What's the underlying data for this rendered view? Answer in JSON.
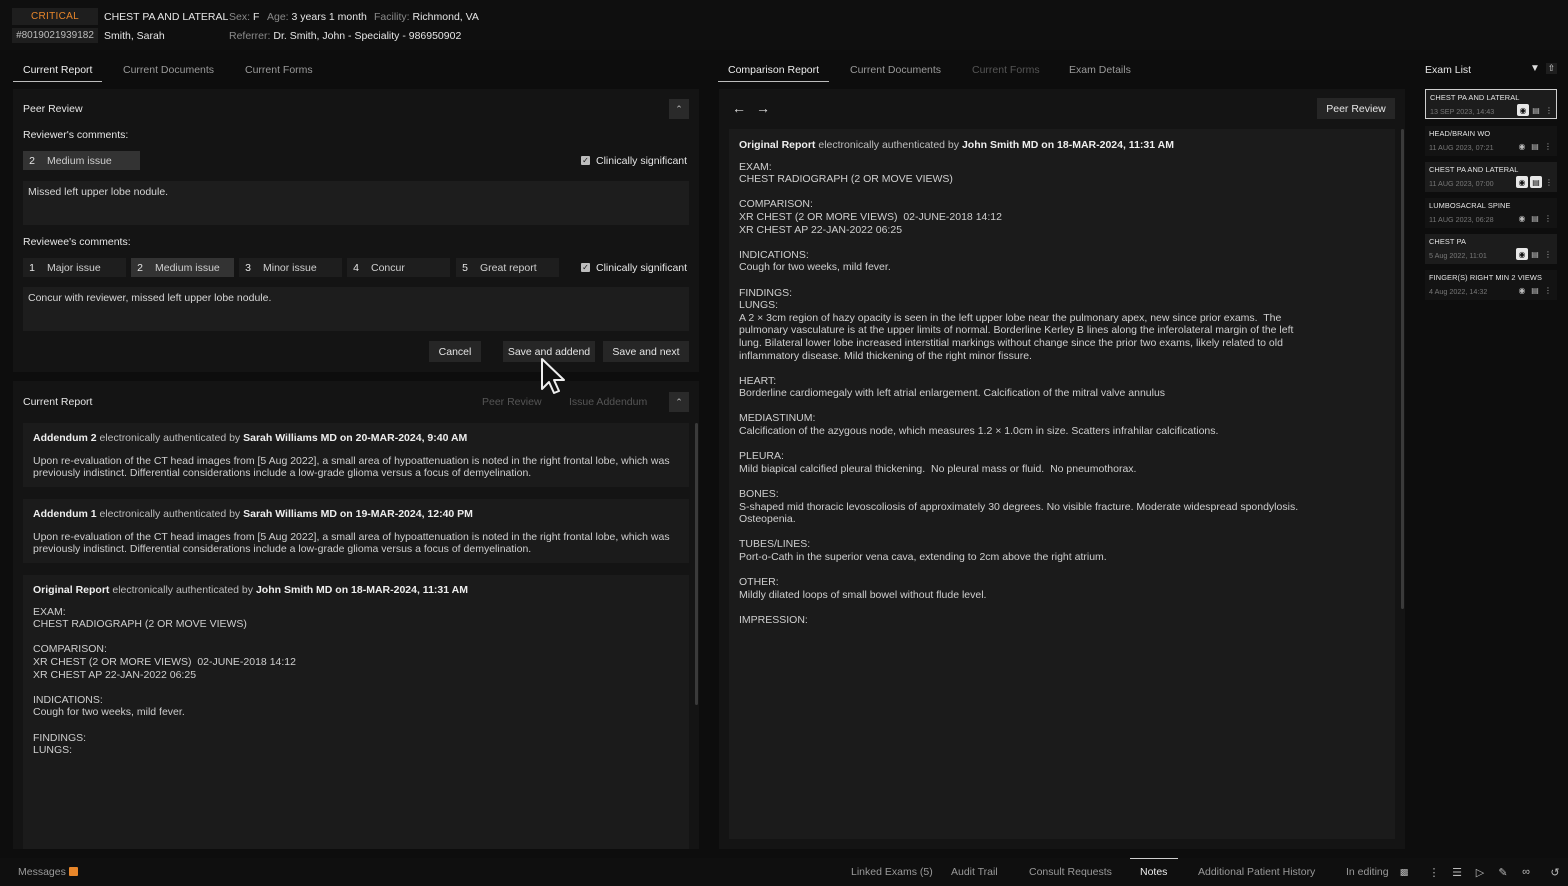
{
  "header": {
    "priority": "CRITICAL",
    "mrn": "#8019021939182",
    "exam_title": "CHEST PA AND LATERAL",
    "patient_name": "Smith, Sarah",
    "sex_label": "Sex:",
    "sex": "F",
    "age_label": "Age:",
    "age": "3 years 1 month",
    "facility_label": "Facility:",
    "facility": "Richmond, VA",
    "referrer_label": "Referrer:",
    "referrer": "Dr. Smith, John - Speciality - 986950902"
  },
  "left_tabs": [
    "Current Report",
    "Current Documents",
    "Current Forms"
  ],
  "right_tabs": [
    "Comparison Report",
    "Current Documents",
    "Current Forms",
    "Exam Details"
  ],
  "peer_review": {
    "title": "Peer Review",
    "reviewer_label": "Reviewer's comments:",
    "reviewer_score_num": "2",
    "reviewer_score_text": "Medium issue",
    "clinically_significant": "Clinically significant",
    "reviewer_comment": "Missed left upper lobe nodule.",
    "reviewee_label": "Reviewee's comments:",
    "options": [
      {
        "num": "1",
        "text": "Major issue"
      },
      {
        "num": "2",
        "text": "Medium issue"
      },
      {
        "num": "3",
        "text": "Minor issue"
      },
      {
        "num": "4",
        "text": "Concur"
      },
      {
        "num": "5",
        "text": "Great report"
      }
    ],
    "reviewee_comment": "Concur with reviewer, missed left upper lobe nodule.",
    "cancel": "Cancel",
    "save_addend": "Save and addend",
    "save_next": "Save and next"
  },
  "current_report": {
    "title": "Current Report",
    "peer_review_action": "Peer Review",
    "issue_addendum_action": "Issue Addendum",
    "addendum2": {
      "title": "Addendum 2",
      "auth": " electronically authenticated by ",
      "author": "Sarah Williams MD on 20-MAR-2024, 9:40 AM",
      "body": "Upon re-evaluation of the CT head images from [5 Aug 2022], a small area of hypoattenuation is noted in the right frontal lobe, which was previously indistinct. Differential considerations include a low-grade glioma versus a focus of demyelination."
    },
    "addendum1": {
      "title": "Addendum 1",
      "auth": " electronically authenticated by ",
      "author": "Sarah Williams MD on 19-MAR-2024, 12:40 PM",
      "body": "Upon re-evaluation of the CT head images from [5 Aug 2022], a small area of hypoattenuation is noted in the right frontal lobe, which was previously indistinct. Differential considerations include a low-grade glioma versus a focus of demyelination."
    },
    "original": {
      "title": "Original Report",
      "auth": " electronically authenticated by ",
      "author": "John Smith MD on 18-MAR-2024, 11:31 AM",
      "body": "EXAM:\nCHEST RADIOGRAPH (2 OR MOVE VIEWS)\n\nCOMPARISON:\nXR CHEST (2 OR MORE VIEWS)  02-JUNE-2018 14:12\nXR CHEST AP 22-JAN-2022 06:25\n\nINDICATIONS:\nCough for two weeks, mild fever.\n\nFINDINGS:\nLUNGS:"
    }
  },
  "comparison": {
    "peer_review_button": "Peer Review",
    "title": "Original Report",
    "auth": " electronically authenticated by ",
    "author": "John Smith MD on 18-MAR-2024, 11:31 AM",
    "body": "EXAM:\nCHEST RADIOGRAPH (2 OR MOVE VIEWS)\n\nCOMPARISON:\nXR CHEST (2 OR MORE VIEWS)  02-JUNE-2018 14:12\nXR CHEST AP 22-JAN-2022 06:25\n\nINDICATIONS:\nCough for two weeks, mild fever.\n\nFINDINGS:\nLUNGS:\nA 2 × 3cm region of hazy opacity is seen in the left upper lobe near the pulmonary apex, new since prior exams.  The\npulmonary vasculature is at the upper limits of normal. Borderline Kerley B lines along the inferolateral margin of the left\nlung. Bilateral lower lobe increased interstitial markings without change since the prior two exams, likely related to old\ninflammatory disease. Mild thickening of the right minor fissure.\n\nHEART:\nBorderline cardiomegaly with left atrial enlargement. Calcification of the mitral valve annulus\n\nMEDIASTINUM:\nCalcification of the azygous node, which measures 1.2 × 1.0cm in size. Scatters infrahilar calcifications.\n\nPLEURA:\nMild biapical calcified pleural thickening.  No pleural mass or fluid.  No pneumothorax.\n\nBONES:\nS-shaped mid thoracic levoscoliosis of approximately 30 degrees. No visible fracture. Moderate widespread spondylosis.\nOsteopenia.\n\nTUBES/LINES:\nPort-o-Cath in the superior vena cava, extending to 2cm above the right atrium.\n\nOTHER:\nMildly dilated loops of small bowel without flude level.\n\nIMPRESSION:"
  },
  "exam_list": {
    "title": "Exam List",
    "items": [
      {
        "title": "CHEST PA AND LATERAL",
        "date": "13 SEP 2023, 14:43"
      },
      {
        "title": "HEAD/BRAIN WO",
        "date": "11 AUG 2023, 07:21"
      },
      {
        "title": "CHEST PA AND LATERAL",
        "date": "11 AUG 2023, 07:00"
      },
      {
        "title": "LUMBOSACRAL SPINE",
        "date": "11 AUG 2023, 06:28"
      },
      {
        "title": "CHEST PA",
        "date": "5 Aug 2022, 11:01"
      },
      {
        "title": "FINGER(S) RIGHT MIN 2 VIEWS",
        "date": "4 Aug 2022, 14:32"
      }
    ]
  },
  "footer": {
    "messages": "Messages",
    "tabs": [
      "Linked Exams (5)",
      "Audit Trail",
      "Consult Requests",
      "Notes",
      "Additional Patient History"
    ],
    "status": "In editing"
  },
  "colors": {
    "critical": "#e8862a",
    "accent_badge": "#e8862a"
  }
}
